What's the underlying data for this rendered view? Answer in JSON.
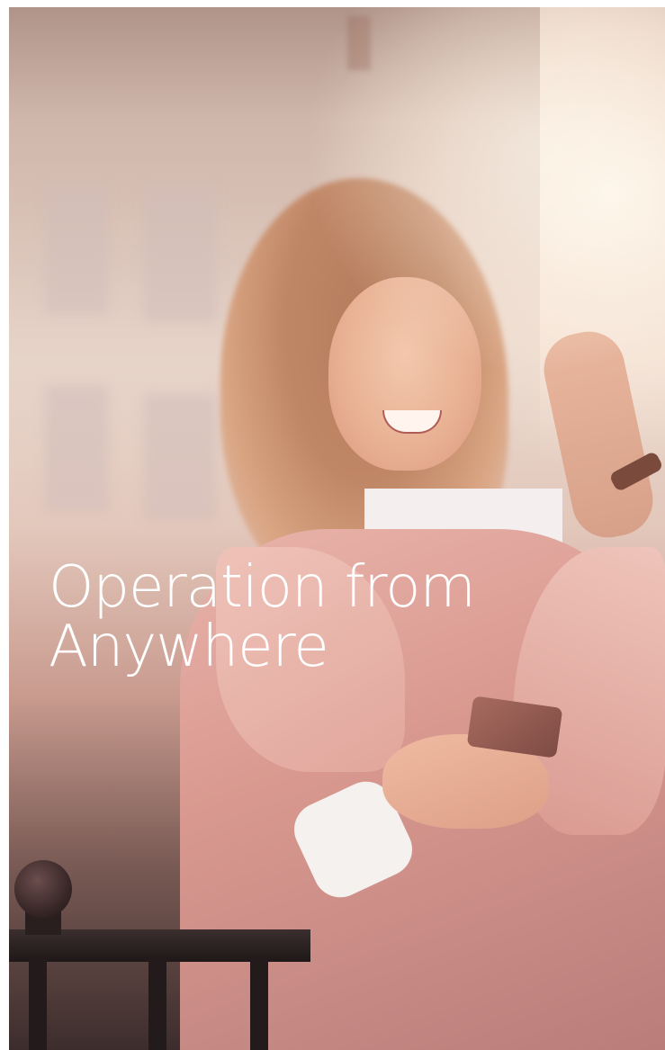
{
  "hero": {
    "headline_line1": "Operation from",
    "headline_line2": "Anywhere"
  },
  "colors": {
    "headline": "#ffffff",
    "coat": "#d99990",
    "background_light": "#e9d7cc"
  }
}
